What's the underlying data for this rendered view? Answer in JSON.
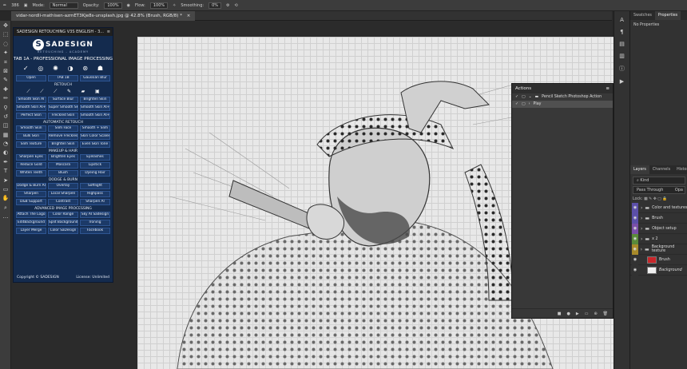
{
  "options_bar": {
    "size": "386",
    "mode_label": "Mode:",
    "mode_value": "Normal",
    "opacity_label": "Opacity:",
    "opacity_value": "100%",
    "flow_label": "Flow:",
    "flow_value": "100%",
    "smoothing_label": "Smoothing:",
    "smoothing_value": "0%"
  },
  "document_tab": {
    "title": "vidar-nordli-mathisen-azmET3Kje8s-unsplash.jpg @ 42.8% (Brush, RGB/8) *"
  },
  "plugin": {
    "title": "SADESIGN RETOUCHING V3S ENGLISH - 3...",
    "brand_name": "SADESIGN",
    "brand_sub": "RETOUCHING - ACADEMY",
    "tab_line": "TAB 1A - PROFESSIONAL IMAGE PROCESSING",
    "row_top": [
      "Open",
      "TAB 1B",
      "Gaussian Blur"
    ],
    "sections": {
      "retouch": "RETOUCH",
      "auto_retouch": "AUTOMATIC RETOUCH",
      "makeup": "MAKEUP & HAIR",
      "dodge": "DODGE & BURN",
      "advanced": "ADVANCED IMAGE PROCESSING"
    },
    "retouch_rows": [
      [
        "Smooth Skin AI",
        "Surface Blur",
        "Brighten Skin"
      ],
      [
        "Smooth Skin AI+",
        "Super Smooth Skin",
        "Smooth Skin AI++"
      ],
      [
        "Perfect Skin",
        "Freckled Skin",
        "Smooth Skin AI+++"
      ]
    ],
    "auto_rows": [
      [
        "Smooth Skin",
        "Slim Face",
        "Smooth + Slim"
      ],
      [
        "Bulk Skin",
        "Remove Freckles",
        "Skin Color Scales"
      ],
      [
        "Slim Texture",
        "Brighten Skin",
        "Even Skin Tone"
      ]
    ],
    "makeup_rows": [
      [
        "Sharpen Eyes",
        "Brighten Eyes",
        "Eyelashes"
      ],
      [
        "Reduce Gold",
        "Mascara",
        "Lipstick"
      ],
      [
        "Whiten Teeth",
        "Blush",
        "Dyeing Hair"
      ]
    ],
    "dodge_rows": [
      [
        "Dodge & Burn AI",
        "Overlay",
        "Softlight"
      ],
      [
        "Sharpen",
        "Local Sharpen",
        "Highpass"
      ],
      [
        "D&B Support",
        "Contrast",
        "Sharpen AI"
      ]
    ],
    "advanced_rows": [
      [
        "Attach The Logo",
        "Color Range",
        "Sky AI Sadesign"
      ],
      [
        "EditBackground",
        "Split Background",
        "Ironing"
      ],
      [
        "Layer Merge",
        "Color SaDesign",
        "Facebook"
      ]
    ],
    "footer_left": "Copyright © SADESIGN",
    "footer_right": "License: Unlimited"
  },
  "actions_panel": {
    "title": "Actions",
    "rows": [
      {
        "label": "Pencil Sketch Photoshop Action",
        "selected": false
      },
      {
        "label": "Play",
        "selected": true
      }
    ]
  },
  "right_panel": {
    "tabs": [
      "Swatches",
      "Properties"
    ],
    "active_tab": "Properties",
    "no_properties": "No Properties",
    "layer_tabs": [
      "Layers",
      "Channels",
      "History"
    ],
    "filter": "Kind",
    "blend_mode": "Pass Through",
    "opacity_short": "Opa",
    "lock_label": "Lock:",
    "layers": [
      {
        "name": "Color and textures",
        "color": "#5b4fa8",
        "type": "folder"
      },
      {
        "name": "Brush",
        "color": "#5b4fa8",
        "type": "folder"
      },
      {
        "name": "Object setup",
        "color": "#7a4fa8",
        "type": "folder"
      },
      {
        "name": "x 2",
        "color": "#5a8a3a",
        "type": "folder"
      },
      {
        "name": "Background texture",
        "color": "#a88a2a",
        "type": "folder"
      },
      {
        "name": "Brush",
        "color": "#323232",
        "type": "red-thumb"
      },
      {
        "name": "Background",
        "color": "#323232",
        "type": "photo"
      }
    ]
  },
  "icons": {
    "tools": [
      "move-icon",
      "marquee-icon",
      "lasso-icon",
      "quick-select-icon",
      "crop-icon",
      "frame-icon",
      "eyedropper-icon",
      "healing-icon",
      "brush-icon",
      "stamp-icon",
      "history-brush-icon",
      "eraser-icon",
      "gradient-icon",
      "blur-icon",
      "dodge-icon",
      "pen-icon",
      "type-icon",
      "path-select-icon",
      "shape-icon",
      "hand-icon",
      "zoom-icon",
      "more-icon"
    ],
    "tool_glyphs": [
      "✥",
      "⬚",
      "◌",
      "✦",
      "⌗",
      "⊠",
      "✎",
      "✚",
      "✏",
      "⚲",
      "↺",
      "◫",
      "▦",
      "◔",
      "◐",
      "✒",
      "T",
      "➤",
      "▭",
      "✋",
      "⌕",
      "…"
    ]
  }
}
